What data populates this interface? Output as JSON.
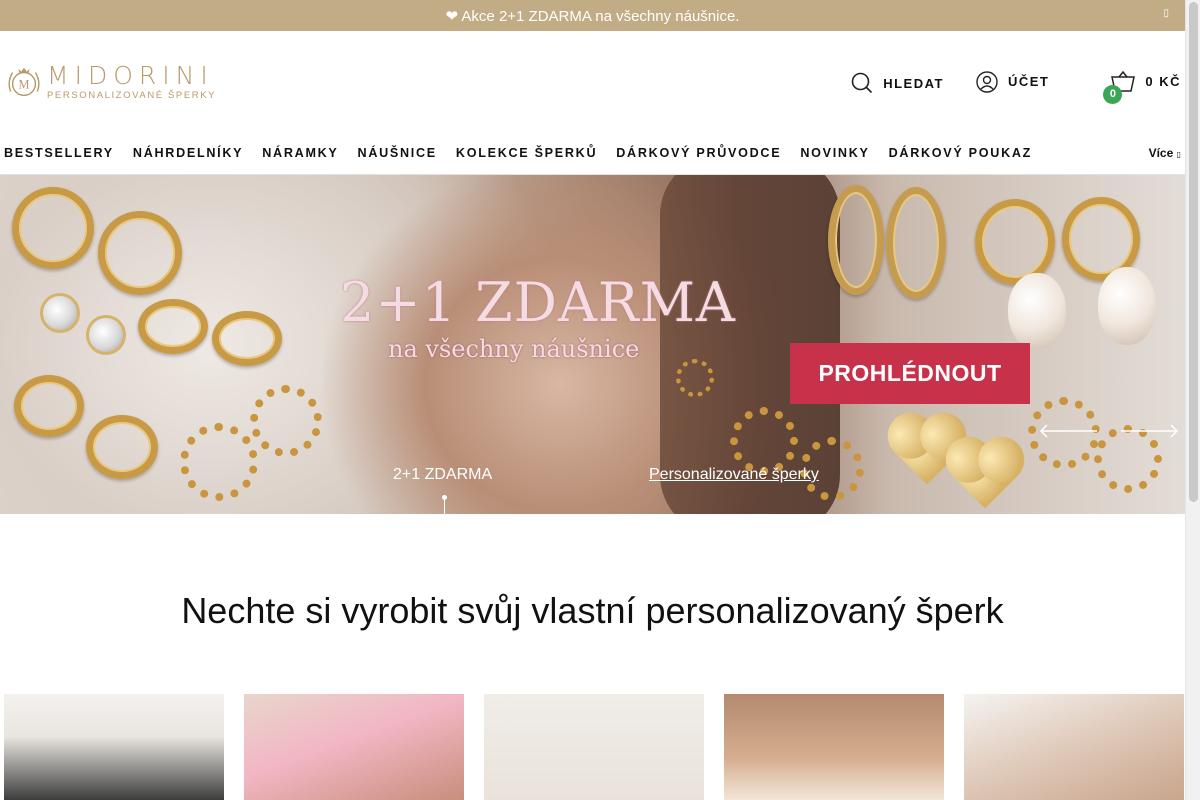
{
  "announcement": {
    "text": "❤ Akce 2+1 ZDARMA na všechny náušnice.",
    "close_icon": "close-icon"
  },
  "header": {
    "logo": {
      "brand": "MIDORINI",
      "tagline": "PERSONALIZOVANÉ ŠPERKY",
      "crest_letter": "M"
    },
    "search_label": "HLEDAT",
    "account_label": "ÚČET",
    "cart": {
      "total": "0 KČ",
      "count": "0"
    }
  },
  "nav": {
    "items": [
      "BESTSELLERY",
      "NÁHRDELNÍKY",
      "NÁRAMKY",
      "NÁUŠNICE",
      "KOLEKCE ŠPERKŮ",
      "DÁRKOVÝ PRŮVODCE",
      "NOVINKY",
      "DÁRKOVÝ POUKAZ"
    ],
    "more_label": "Více"
  },
  "hero": {
    "headline": "2+1 ZDARMA",
    "subline": "na všechny náušnice",
    "cta": "PROHLÉDNOUT",
    "slide_tabs": [
      "2+1 ZDARMA",
      "Personalizované šperky"
    ]
  },
  "section": {
    "title": "Nechte si vyrobit svůj vlastní personalizovaný šperk"
  },
  "colors": {
    "announcement_bg": "#c2ac86",
    "logo_gold": "#b89a6a",
    "cta_red": "#c8314a",
    "badge_green": "#3aa757"
  }
}
